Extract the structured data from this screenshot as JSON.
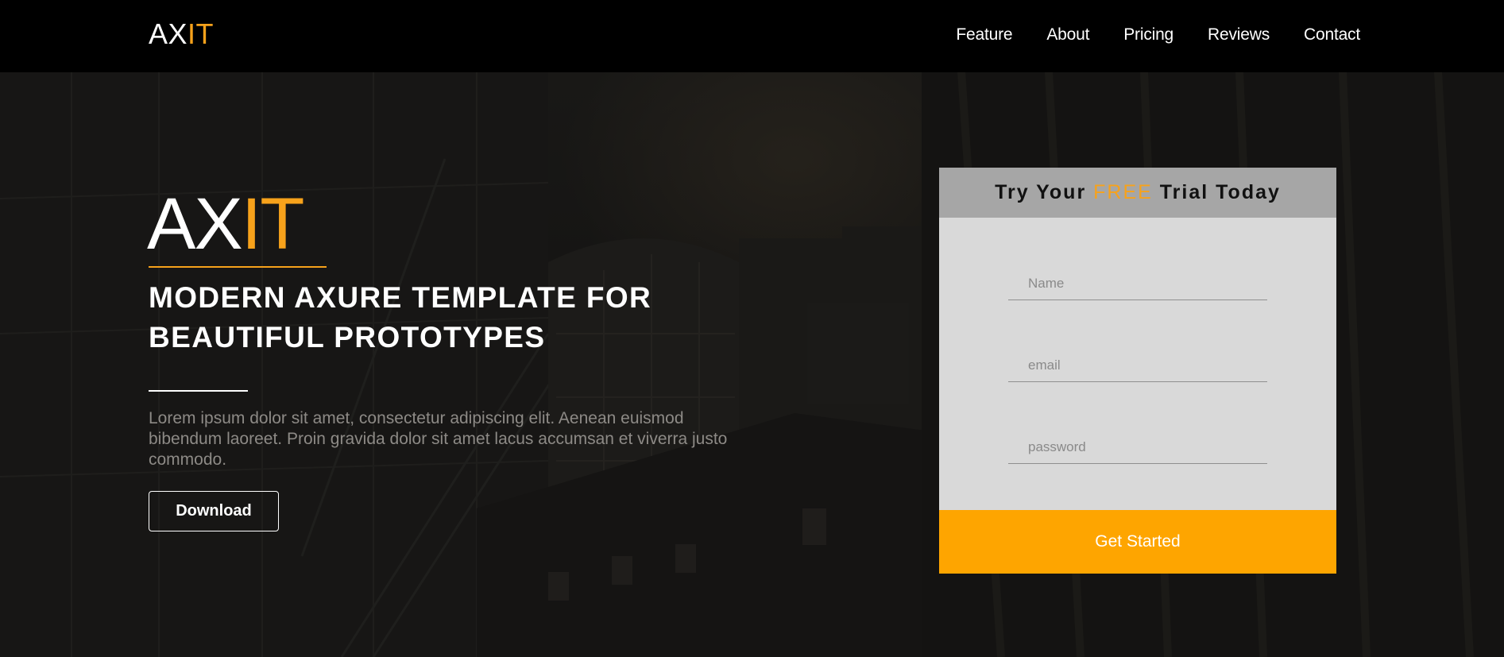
{
  "colors": {
    "accent": "#f7a21b",
    "navbar_bg": "#000000",
    "card_header_bg": "#a6a6a6",
    "card_body_bg": "#d9d9d9",
    "cta_bg": "#fea500"
  },
  "navbar": {
    "logo_main": "AX",
    "logo_accent": "IT",
    "links": [
      "Feature",
      "About",
      "Pricing",
      "Reviews",
      "Contact"
    ]
  },
  "hero": {
    "logo_main": "AX",
    "logo_accent": "IT",
    "title_line_1": "MODERN AXURE TEMPLATE FOR",
    "title_line_2": "BEAUTIFUL PROTOTYPES",
    "description": "Lorem ipsum dolor sit amet, consectetur adipiscing elit. Aenean euismod bibendum laoreet. Proin gravida dolor sit amet lacus accumsan et viverra justo commodo.",
    "download_label": "Download"
  },
  "signup": {
    "heading_before": "Try Your",
    "heading_highlight": "FREE",
    "heading_after": "Trial Today",
    "name_placeholder": "Name",
    "email_placeholder": "email",
    "password_placeholder": "password",
    "submit_label": "Get Started"
  }
}
